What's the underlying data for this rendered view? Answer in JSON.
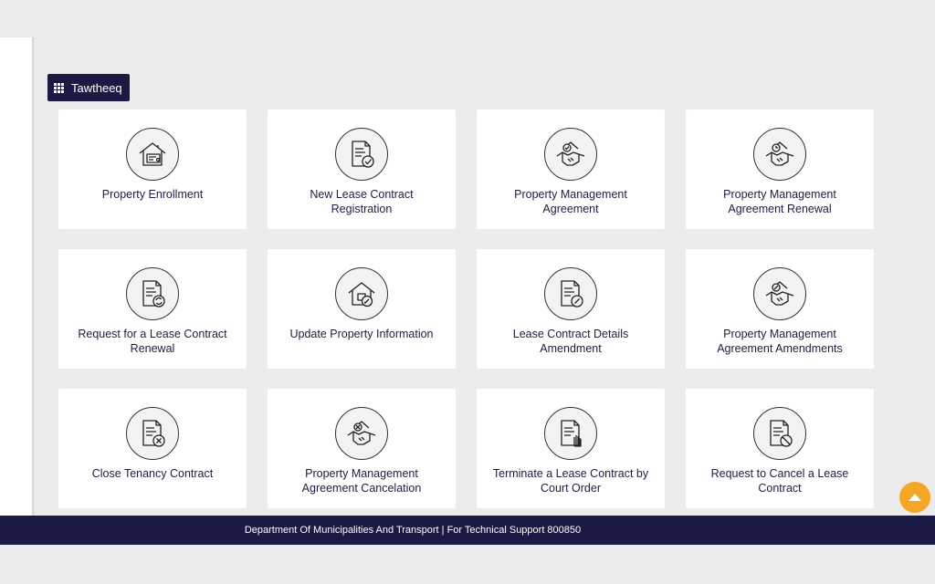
{
  "app_tab": {
    "label": "Tawtheeq",
    "icon": "grid-icon"
  },
  "services": [
    {
      "label": "Property Enrollment",
      "icon": "house-certificate-icon"
    },
    {
      "label": "New Lease Contract Registration",
      "icon": "document-check-icon"
    },
    {
      "label": "Property Management Agreement",
      "icon": "handshake-check-icon"
    },
    {
      "label": "Property Management Agreement Renewal",
      "icon": "handshake-clock-icon"
    },
    {
      "label": "Request for a Lease Contract Renewal",
      "icon": "document-renew-icon"
    },
    {
      "label": "Update Property Information",
      "icon": "house-edit-icon"
    },
    {
      "label": "Lease Contract Details Amendment",
      "icon": "document-edit-icon"
    },
    {
      "label": "Property Management Agreement Amendments",
      "icon": "handshake-edit-icon"
    },
    {
      "label": "Close Tenancy Contract",
      "icon": "document-close-icon"
    },
    {
      "label": "Property Management Agreement Cancelation",
      "icon": "handshake-cancel-icon"
    },
    {
      "label": "Terminate a Lease Contract by Court Order",
      "icon": "document-hand-icon"
    },
    {
      "label": "Request to Cancel a Lease Contract",
      "icon": "document-ban-icon"
    }
  ],
  "footer": {
    "text": "Department Of Municipalities And Transport | For Technical Support 800850"
  },
  "scroll_top": {
    "icon": "arrow-up-icon",
    "color": "#f5a623"
  },
  "colors": {
    "navy": "#1b1a45",
    "accent": "#f5a623"
  }
}
